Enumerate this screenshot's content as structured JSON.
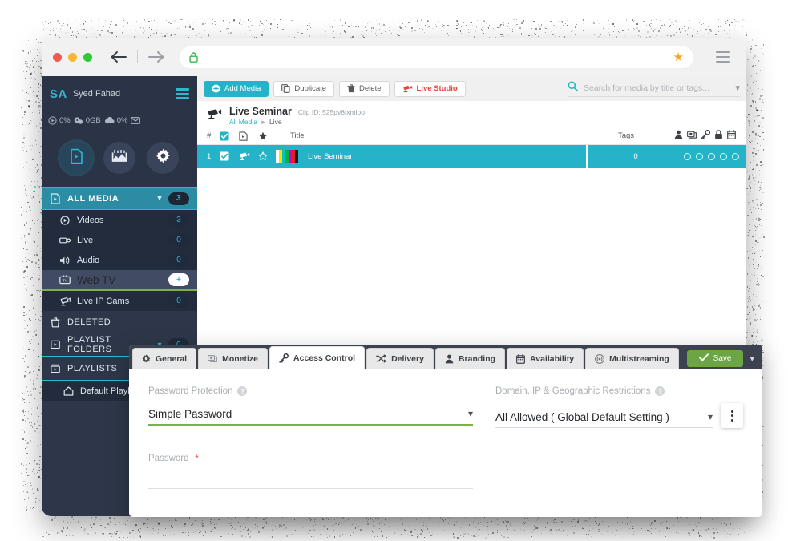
{
  "browser": {
    "url_value": "",
    "url_placeholder": "",
    "back_icon": "back-arrow-icon",
    "forward_icon": "forward-arrow-icon",
    "lock_icon": "lock-icon",
    "star_icon": "bookmark-star-icon",
    "menu_icon": "hamburger-menu-icon"
  },
  "sidebar": {
    "initials": "SA",
    "user_name": "Syed Fahad",
    "menu_icon": "hamburger-menu-icon",
    "stats": [
      {
        "icon": "play-circle-icon",
        "value": "0%"
      },
      {
        "icon": "bandwidth-icon",
        "value": "0GB"
      },
      {
        "icon": "cloud-icon",
        "value": "0%"
      },
      {
        "icon": "mail-icon",
        "value": ""
      }
    ],
    "modes": [
      {
        "icon": "media-file-icon",
        "name": "media-mode",
        "active": true
      },
      {
        "icon": "analytics-icon",
        "name": "analytics-mode",
        "active": false
      },
      {
        "icon": "gear-icon",
        "name": "settings-mode",
        "active": false
      }
    ],
    "all_media": {
      "label": "ALL MEDIA",
      "count": "3",
      "icon": "media-file-icon",
      "chevron": "chevron-down-icon"
    },
    "items": [
      {
        "label": "Videos",
        "count": "3",
        "icon": "play-circle-icon",
        "selected": false
      },
      {
        "label": "Live",
        "count": "0",
        "icon": "live-camera-icon",
        "selected": false
      },
      {
        "label": "Audio",
        "count": "0",
        "icon": "speaker-icon",
        "selected": false
      },
      {
        "label": "Web TV",
        "count": "+",
        "icon": "tv-icon",
        "selected": true
      },
      {
        "label": "Live IP Cams",
        "count": "0",
        "icon": "ip-camera-icon",
        "selected": false
      }
    ],
    "deleted": {
      "label": "DELETED",
      "icon": "trash-icon"
    },
    "playlist_folders": {
      "label": "PLAYLIST FOLDERS",
      "count": "0",
      "icon": "folder-icon",
      "chevron": "chevron-down-icon"
    },
    "playlists": {
      "label": "PLAYLISTS",
      "icon": "playlist-icon"
    },
    "default_playlist": {
      "label": "Default Playlist",
      "icon": "home-icon"
    }
  },
  "toolbar": {
    "add_media": "Add Media",
    "duplicate": "Duplicate",
    "delete": "Delete",
    "live_studio": "Live Studio"
  },
  "search": {
    "placeholder": "Search for media by title or tags...",
    "value": "",
    "icon": "search-icon",
    "chevron": "chevron-down-icon"
  },
  "clip": {
    "title": "Live Seminar",
    "clip_id_label": "Clip ID: 525pv8txmloo",
    "icon": "live-camera-icon",
    "breadcrumb_root": "All Media",
    "breadcrumb_sep": "▸",
    "breadcrumb_current": "Live"
  },
  "table": {
    "headers": {
      "num": "#",
      "checkbox": "select-all",
      "type": "type",
      "star": "favorite",
      "title": "Title",
      "tags": "Tags"
    },
    "header_icons": [
      "person-icon",
      "monetize-icon",
      "key-icon",
      "lock-icon",
      "calendar-icon"
    ],
    "rows": [
      {
        "num": "1",
        "checked": true,
        "type_icon": "live-camera-icon",
        "star_icon": "star-outline-icon",
        "thumbnail": "color-bars-thumbnail",
        "title": "Live Seminar",
        "tags": "0",
        "status_icons": [
          "circle-outline-icon",
          "circle-outline-icon",
          "circle-outline-icon",
          "circle-outline-icon",
          "circle-outline-icon"
        ]
      }
    ]
  },
  "panel": {
    "tabs": [
      {
        "label": "General",
        "icon": "gear-icon",
        "active": false
      },
      {
        "label": "Monetize",
        "icon": "monetize-icon",
        "active": false
      },
      {
        "label": "Access Control",
        "icon": "key-icon",
        "active": true
      },
      {
        "label": "Delivery",
        "icon": "shuffle-icon",
        "active": false
      },
      {
        "label": "Branding",
        "icon": "person-icon",
        "active": false
      },
      {
        "label": "Availability",
        "icon": "calendar-icon",
        "active": false
      },
      {
        "label": "Multistreaming",
        "icon": "broadcast-icon",
        "active": false
      }
    ],
    "save_label": "Save",
    "save_icon": "check-icon",
    "save_chevron": "chevron-down-icon",
    "form": {
      "password_protection": {
        "label": "Password Protection",
        "help_icon": "help-icon",
        "value": "Simple Password",
        "chevron": "chevron-down-icon"
      },
      "restrictions": {
        "label": "Domain, IP & Geographic Restrictions",
        "help_icon": "help-icon",
        "value": "All Allowed ( Global Default Setting )",
        "chevron": "chevron-down-icon",
        "kebab_icon": "kebab-menu-icon"
      },
      "password": {
        "label": "Password",
        "required_marker": "*",
        "value": "",
        "placeholder": ""
      }
    }
  },
  "colors": {
    "accent": "#26b3c9",
    "sidebar_bg": "#2e3749",
    "save_green": "#6ca644",
    "underline_green": "#7cb342",
    "danger_red": "#e8443a",
    "star_orange": "#f5a623"
  }
}
